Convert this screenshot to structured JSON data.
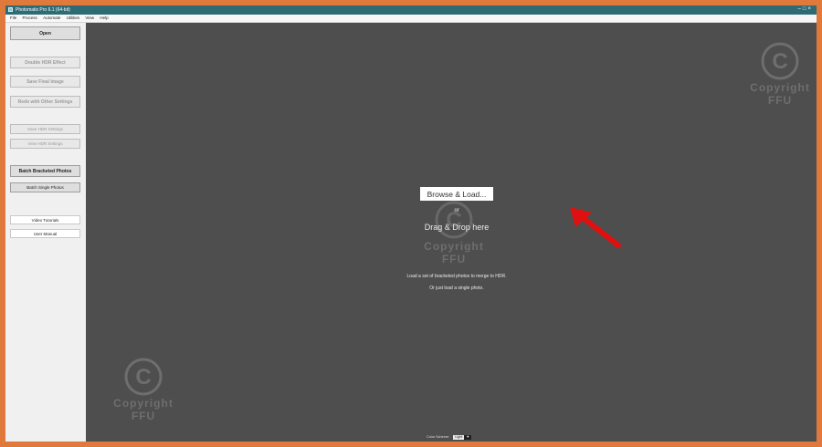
{
  "window": {
    "title": "Photomatix Pro 6.1 (64-bit)",
    "controls": [
      "–",
      "□",
      "×"
    ]
  },
  "menu": [
    "File",
    "Process",
    "Automate",
    "Utilities",
    "View",
    "Help"
  ],
  "sidebar": {
    "open": "Open",
    "double_hdr": "Double HDR Effect",
    "save_final": "Save Final Image",
    "redo": "Redo with Other Settings",
    "save_hdr_settings": "Save HDR Settings",
    "view_hdr_settings": "View HDR Settings",
    "batch_bracketed": "Batch Bracketed Photos",
    "batch_single": "Batch Single Photos",
    "video_tutorials": "Video Tutorials",
    "user_manual": "User Manual"
  },
  "main": {
    "browse_button": "Browse & Load...",
    "or_text": "or",
    "drag_drop": "Drag & Drop here",
    "desc_line1": "Load a set of bracketed photos to merge to HDR.",
    "desc_line2": "Or just load a single photo.",
    "color_scheme_label": "Color Scheme:",
    "color_scheme_value": "Light",
    "color_scheme_arrow": "▼"
  },
  "watermark": {
    "symbol": "C",
    "line1": "Copyright",
    "line2": "FFU"
  },
  "colors": {
    "frame": "#e07a3c",
    "titlebar": "#2e6b75",
    "workspace": "#4e4e4e",
    "annotation_arrow": "#e01010"
  },
  "icons": {
    "app": "photomatix-app-icon",
    "annotation": "red-arrow-icon",
    "watermark": "copyright-icon"
  }
}
